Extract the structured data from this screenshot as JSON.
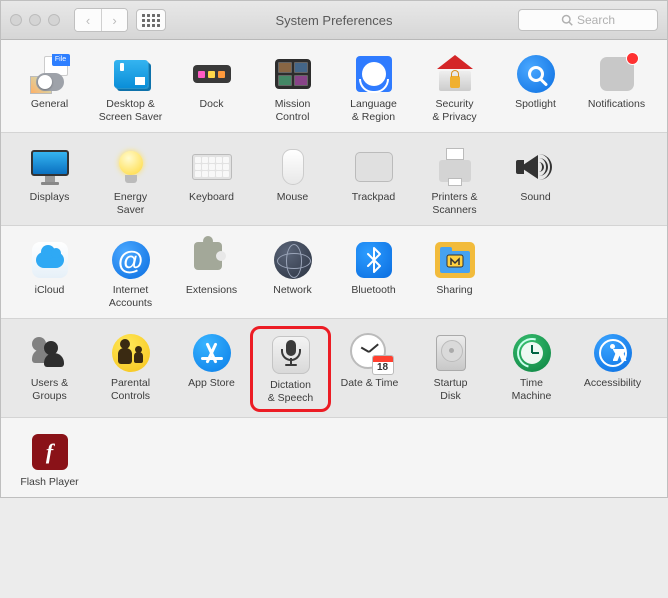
{
  "window": {
    "title": "System Preferences",
    "search_placeholder": "Search"
  },
  "cal_day": "18",
  "rows": [
    {
      "bg": "light",
      "items": [
        {
          "id": "general",
          "label": "General"
        },
        {
          "id": "desktop",
          "label": "Desktop &\nScreen Saver"
        },
        {
          "id": "dock",
          "label": "Dock"
        },
        {
          "id": "mission",
          "label": "Mission\nControl"
        },
        {
          "id": "language",
          "label": "Language\n& Region"
        },
        {
          "id": "security",
          "label": "Security\n& Privacy"
        },
        {
          "id": "spotlight",
          "label": "Spotlight"
        },
        {
          "id": "notifications",
          "label": "Notifications",
          "badge": true
        }
      ]
    },
    {
      "bg": "dark",
      "items": [
        {
          "id": "displays",
          "label": "Displays"
        },
        {
          "id": "energy",
          "label": "Energy\nSaver"
        },
        {
          "id": "keyboard",
          "label": "Keyboard"
        },
        {
          "id": "mouse",
          "label": "Mouse"
        },
        {
          "id": "trackpad",
          "label": "Trackpad"
        },
        {
          "id": "printers",
          "label": "Printers &\nScanners"
        },
        {
          "id": "sound",
          "label": "Sound"
        }
      ]
    },
    {
      "bg": "light",
      "items": [
        {
          "id": "icloud",
          "label": "iCloud"
        },
        {
          "id": "internet",
          "label": "Internet\nAccounts"
        },
        {
          "id": "extensions",
          "label": "Extensions"
        },
        {
          "id": "network",
          "label": "Network"
        },
        {
          "id": "bluetooth",
          "label": "Bluetooth"
        },
        {
          "id": "sharing",
          "label": "Sharing"
        }
      ]
    },
    {
      "bg": "dark",
      "items": [
        {
          "id": "users",
          "label": "Users &\nGroups"
        },
        {
          "id": "parental",
          "label": "Parental\nControls"
        },
        {
          "id": "appstore",
          "label": "App Store"
        },
        {
          "id": "dictation",
          "label": "Dictation\n& Speech",
          "highlight": true
        },
        {
          "id": "datetime",
          "label": "Date & Time"
        },
        {
          "id": "startupdisk",
          "label": "Startup\nDisk"
        },
        {
          "id": "timemachine",
          "label": "Time\nMachine"
        },
        {
          "id": "accessibility",
          "label": "Accessibility"
        }
      ]
    },
    {
      "bg": "light",
      "last": true,
      "items": [
        {
          "id": "flash",
          "label": "Flash Player"
        }
      ]
    }
  ]
}
